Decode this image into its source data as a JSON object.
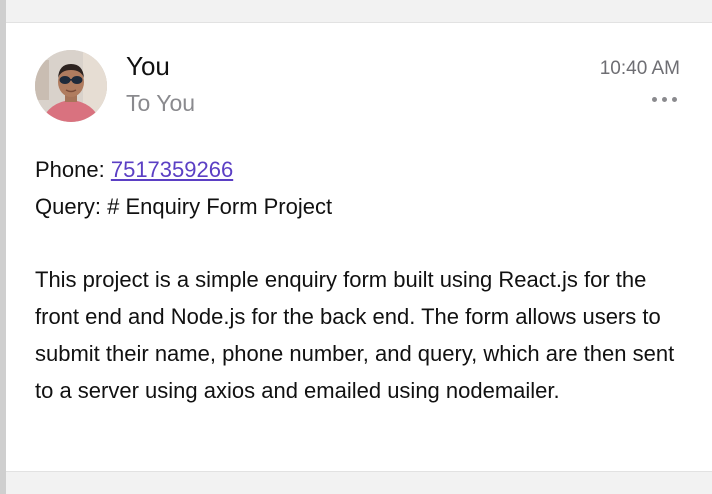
{
  "message": {
    "sender": "You",
    "recipient": "To You",
    "time": "10:40 AM",
    "more_icon": "ellipsis-icon",
    "avatar_icon": "user-avatar-photo",
    "phone_label": "Phone: ",
    "phone_value": "7517359266",
    "query_label": "Query: ",
    "query_value": "# Enquiry Form Project",
    "description": "This project is a simple enquiry form built using React.js for the front end and Node.js for the back end. The form allows users to submit their name, phone number, and query, which are then sent to a server using axios and emailed using nodemailer."
  },
  "colors": {
    "link": "#5b3fc4",
    "secondary_text": "#8a8a8e",
    "background": "#f2f2f2",
    "card": "#ffffff"
  }
}
